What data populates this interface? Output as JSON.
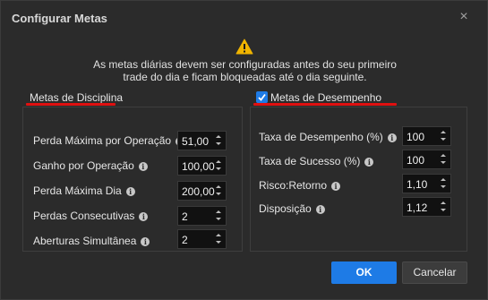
{
  "window": {
    "title": "Configurar Metas",
    "close_glyph": "×"
  },
  "warning": {
    "icon": "warning-triangle-icon",
    "message_line1": "As metas diárias devem ser configuradas antes do seu primeiro",
    "message_line2": "trade do dia e ficam bloqueadas até o dia seguinte."
  },
  "discipline": {
    "title": "Metas de Disciplina",
    "fields": [
      {
        "label": "Perda Máxima por Operação",
        "value": "51,00"
      },
      {
        "label": "Ganho por Operação",
        "value": "100,00"
      },
      {
        "label": "Perda Máxima Dia",
        "value": "200,00"
      },
      {
        "label": "Perdas Consecutivas",
        "value": "2"
      },
      {
        "label": "Aberturas Simultânea",
        "value": "2"
      }
    ]
  },
  "performance": {
    "title": "Metas de Desempenho",
    "checked": true,
    "fields": [
      {
        "label": "Taxa de Desempenho (%)",
        "value": "100"
      },
      {
        "label": "Taxa de Sucesso (%)",
        "value": "100"
      },
      {
        "label": "Risco:Retorno",
        "value": "1,10"
      },
      {
        "label": "Disposição",
        "value": "1,12"
      }
    ]
  },
  "buttons": {
    "ok": "OK",
    "cancel": "Cancelar"
  },
  "colors": {
    "accent": "#1e7be6",
    "underline": "#e01010",
    "background": "#2b2b2b"
  }
}
